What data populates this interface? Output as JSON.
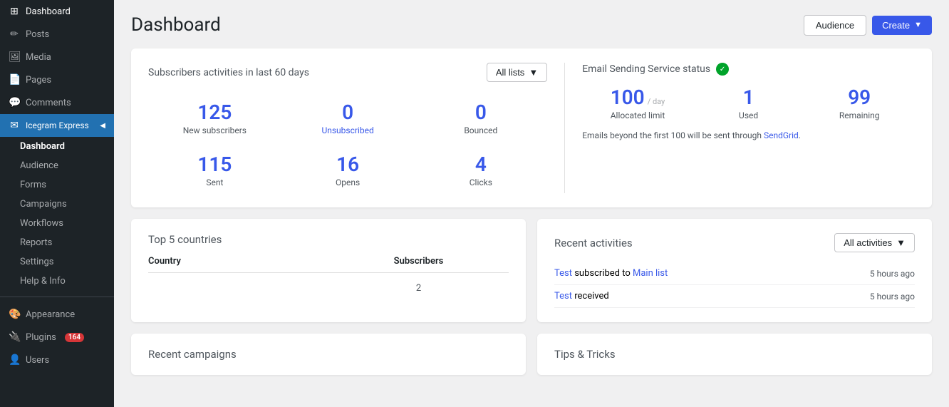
{
  "sidebar": {
    "items": [
      {
        "id": "dashboard-wp",
        "label": "Dashboard",
        "icon": "⊞"
      },
      {
        "id": "posts",
        "label": "Posts",
        "icon": "📝"
      },
      {
        "id": "media",
        "label": "Media",
        "icon": "🖼"
      },
      {
        "id": "pages",
        "label": "Pages",
        "icon": "📄"
      },
      {
        "id": "comments",
        "label": "Comments",
        "icon": "💬"
      },
      {
        "id": "icegram",
        "label": "Icegram Express",
        "icon": "✉",
        "active": true
      },
      {
        "id": "appearance",
        "label": "Appearance",
        "icon": "🎨"
      },
      {
        "id": "plugins",
        "label": "Plugins",
        "icon": "🔌",
        "badge": "164"
      },
      {
        "id": "users",
        "label": "Users",
        "icon": "👤"
      }
    ],
    "sub_items": [
      {
        "id": "ig-dashboard",
        "label": "Dashboard",
        "active": true
      },
      {
        "id": "ig-audience",
        "label": "Audience"
      },
      {
        "id": "ig-forms",
        "label": "Forms"
      },
      {
        "id": "ig-campaigns",
        "label": "Campaigns"
      },
      {
        "id": "ig-workflows",
        "label": "Workflows"
      },
      {
        "id": "ig-reports",
        "label": "Reports"
      },
      {
        "id": "ig-settings",
        "label": "Settings"
      },
      {
        "id": "ig-help",
        "label": "Help & Info"
      }
    ]
  },
  "header": {
    "title": "Dashboard",
    "audience_btn": "Audience",
    "create_btn": "Create"
  },
  "activities_card": {
    "title": "Subscribers activities in last 60 days",
    "dropdown_label": "All lists",
    "stats": [
      {
        "number": "125",
        "label": "New subscribers"
      },
      {
        "number": "0",
        "label": "Unsubscribed",
        "style": "link"
      },
      {
        "number": "0",
        "label": "Bounced"
      },
      {
        "number": "115",
        "label": "Sent"
      },
      {
        "number": "16",
        "label": "Opens"
      },
      {
        "number": "4",
        "label": "Clicks"
      }
    ]
  },
  "email_service": {
    "title": "Email Sending Service status",
    "status": "active",
    "stats": [
      {
        "number": "100",
        "sub": "/ day",
        "label": "Allocated limit"
      },
      {
        "number": "1",
        "label": "Used"
      },
      {
        "number": "99",
        "label": "Remaining"
      }
    ],
    "note_prefix": "Emails beyond the first 100 will be sent through ",
    "note_link": "SendGrid",
    "note_suffix": "."
  },
  "top_countries": {
    "title": "Top 5 countries",
    "col_country": "Country",
    "col_subscribers": "Subscribers",
    "rows": [
      {
        "country": "",
        "subscribers": "2"
      }
    ]
  },
  "recent_activities": {
    "title": "Recent activities",
    "dropdown_label": "All activities",
    "rows": [
      {
        "text_parts": [
          "Test",
          " subscribed to ",
          "Main list"
        ],
        "link1": "Test",
        "link2": "Main list",
        "time": "5 hours ago"
      },
      {
        "text_parts": [
          "Test",
          " received"
        ],
        "link1": "Test",
        "time": "5 hours ago"
      }
    ]
  },
  "bottom": {
    "recent_campaigns": "Recent campaigns",
    "tips_tricks": "Tips & Tricks"
  }
}
